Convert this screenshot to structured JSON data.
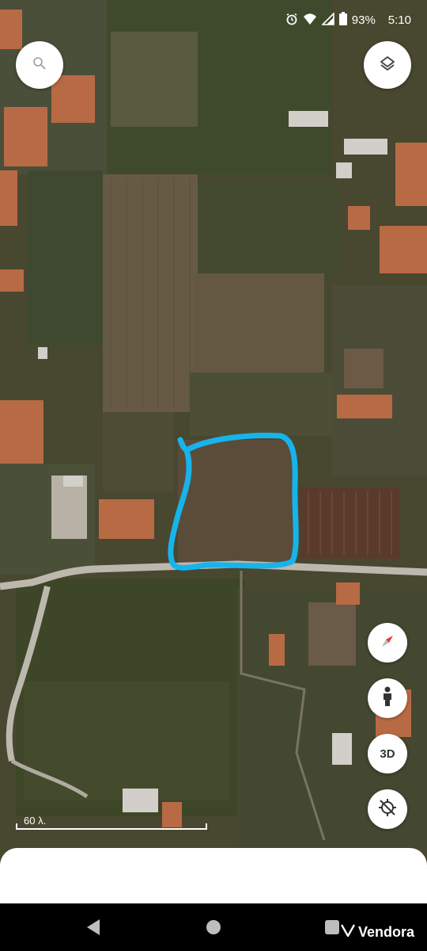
{
  "status_bar": {
    "battery": "93%",
    "time": "5:10",
    "icons": [
      "alarm-icon",
      "wifi-icon",
      "signal-icon",
      "battery-icon"
    ]
  },
  "map": {
    "type": "satellite",
    "scale_label": "60 λ.",
    "highlight_color": "#17b4ec"
  },
  "buttons": {
    "search": "search-icon",
    "layers": "layers-icon",
    "compass": "compass-icon",
    "street_view": "person-icon",
    "three_d": "3D",
    "location": "location-off-icon"
  },
  "nav_bar": {
    "buttons": [
      "back",
      "home",
      "recents"
    ]
  },
  "watermark": "Vendora"
}
